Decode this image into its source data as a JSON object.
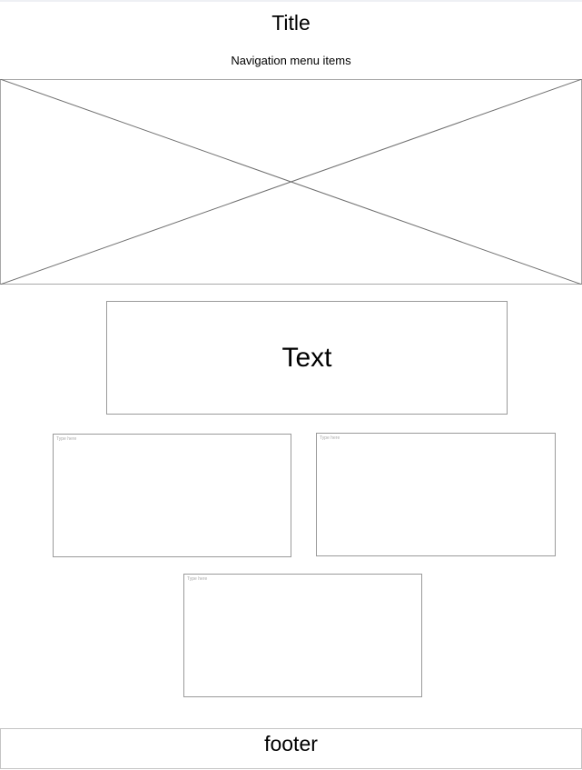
{
  "header": {
    "title": "Title",
    "nav": "Navigation menu items"
  },
  "hero_image": {
    "icon": "image-placeholder-icon"
  },
  "text_block": "Text",
  "text_areas": [
    {
      "placeholder": "Type here"
    },
    {
      "placeholder": "Type here"
    },
    {
      "placeholder": "Type here"
    }
  ],
  "footer": "footer"
}
